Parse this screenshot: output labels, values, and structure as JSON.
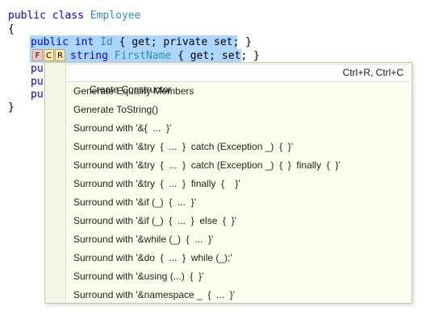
{
  "code": {
    "line1": {
      "kw1": "public",
      "kw2": "class",
      "type": "Employee"
    },
    "line2": {
      "text": "{"
    },
    "line3": {
      "kw1": "public",
      "type": "int",
      "name": "Id",
      "body": "{ get; private set; }"
    },
    "line4": {
      "type": "string",
      "name": "FirstName",
      "body": "{ get; set; }"
    },
    "line5": {
      "text": "pul"
    },
    "line6": {
      "text": "pul"
    },
    "line7": {
      "text": "pul"
    },
    "line8": {
      "text": "}"
    }
  },
  "badges": [
    "F",
    "C",
    "R"
  ],
  "menu": {
    "items": [
      {
        "label": "Create Constructor",
        "shortcut": "Ctrl+R, Ctrl+C"
      },
      {
        "label": "Generate Equality Members",
        "shortcut": ""
      },
      {
        "label": "Generate ToString()",
        "shortcut": ""
      },
      {
        "label": "Surround with '&{  ...  }'",
        "shortcut": ""
      },
      {
        "label": "Surround with '&try  {  ...  }  catch (Exception _)  {  }'",
        "shortcut": ""
      },
      {
        "label": "Surround with '&try  {  ...  }  catch (Exception _)  {  }  finally  {  }'",
        "shortcut": ""
      },
      {
        "label": "Surround with '&try  {  ...  }  finally  {    }'",
        "shortcut": ""
      },
      {
        "label": "Surround with '&if (_)  {  ...  }'",
        "shortcut": ""
      },
      {
        "label": "Surround with '&if (_)  {  ...  }  else  {  }'",
        "shortcut": ""
      },
      {
        "label": "Surround with '&while (_)  {  ...  }'",
        "shortcut": ""
      },
      {
        "label": "Surround with '&do  {  ...  }  while (_);'",
        "shortcut": ""
      },
      {
        "label": "Surround with '&using (...)  {  }'",
        "shortcut": ""
      },
      {
        "label": "Surround with '&namespace _  {  ...  }'",
        "shortcut": ""
      }
    ]
  },
  "colors": {
    "keyword": "#0000ff",
    "type": "#2b91af",
    "selection": "#add6ff",
    "popup_background": "#fefef0"
  }
}
